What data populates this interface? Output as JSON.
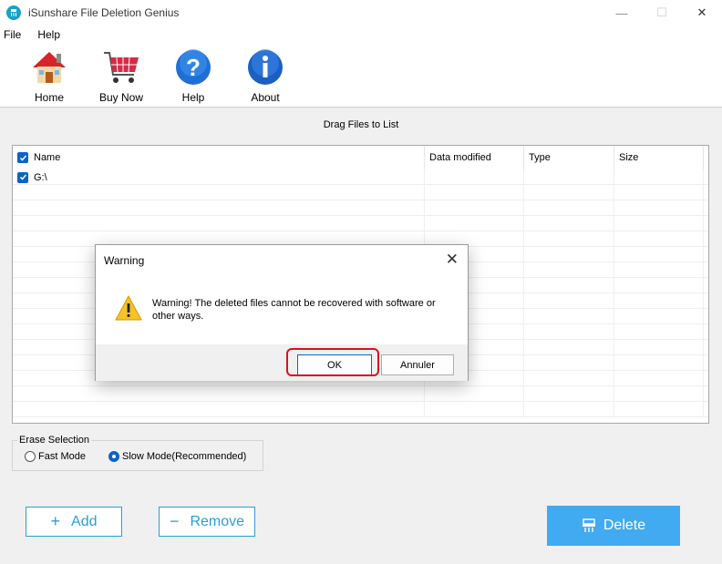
{
  "window": {
    "title": "iSunshare File Deletion Genius",
    "controls": [
      "—",
      "☐",
      "✕"
    ]
  },
  "menu": [
    "File",
    "Help"
  ],
  "toolbar": {
    "home_label": "Home",
    "buynow_label": "Buy Now",
    "help_label": "Help",
    "about_label": "About"
  },
  "list": {
    "drag_label": "Drag Files to List",
    "columns": [
      "Name",
      "Data modified",
      "Type",
      "Size"
    ],
    "rows": [
      {
        "name": "G:\\",
        "modified": "",
        "type": "",
        "size": "",
        "checked": true
      }
    ]
  },
  "erase": {
    "legend": "Erase Selection",
    "fast_label": "Fast Mode",
    "slow_label": "Slow Mode(Recommended)",
    "selected": "slow"
  },
  "buttons": {
    "add_label": "Add",
    "add_symbol": "+",
    "remove_label": "Remove",
    "remove_symbol": "−",
    "delete_label": "Delete"
  },
  "dialog": {
    "title": "Warning",
    "message": "Warning! The deleted files cannot be recovered with software or other ways.",
    "ok_label": "OK",
    "cancel_label": "Annuler"
  },
  "colors": {
    "accent": "#2b9ed8",
    "delete_button": "#42aaf0",
    "checkbox": "#0a64c8",
    "highlight": "#d8121e"
  }
}
